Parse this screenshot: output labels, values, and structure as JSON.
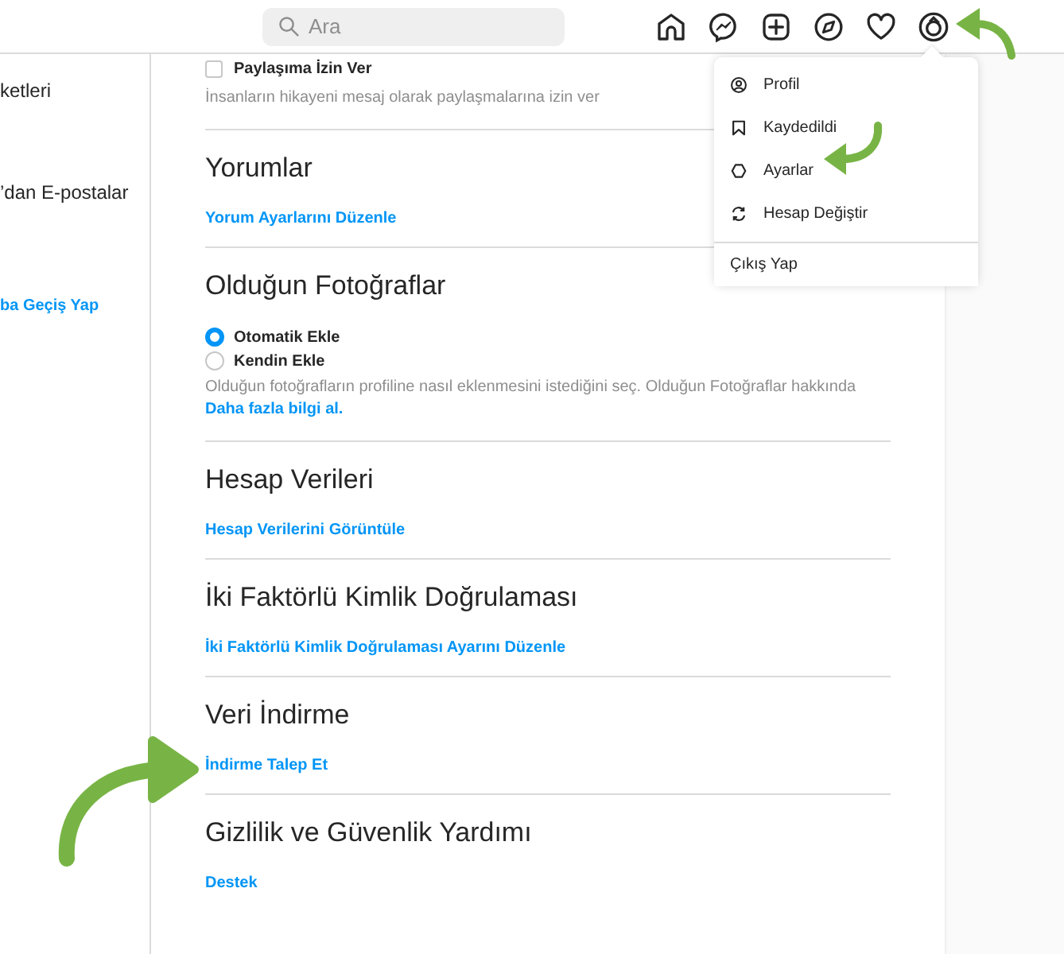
{
  "header": {
    "search": {
      "placeholder": "Ara"
    },
    "nav_icons": [
      {
        "kind": "home"
      },
      {
        "kind": "messenger"
      },
      {
        "kind": "new-post"
      },
      {
        "kind": "explore"
      },
      {
        "kind": "activity"
      },
      {
        "kind": "profile"
      }
    ]
  },
  "sidebar": {
    "items": [
      {
        "label": "ketleri",
        "kind": "plain"
      },
      {
        "label": "’dan E-postalar",
        "kind": "plain"
      },
      {
        "label": "ba Geçiş Yap",
        "kind": "link"
      }
    ]
  },
  "top_option": {
    "label": "Paylaşıma İzin Ver",
    "checked": false,
    "description": "İnsanların hikayeni mesaj olarak paylaşmalarına izin ver"
  },
  "sections": [
    {
      "title": "Yorumlar",
      "link": "Yorum Ayarlarını Düzenle"
    },
    {
      "title": "Olduğun Fotoğraflar",
      "options": [
        {
          "label": "Otomatik Ekle",
          "selected": true
        },
        {
          "label": "Kendin Ekle",
          "selected": false
        }
      ],
      "description": "Olduğun fotoğrafların profiline nasıl eklenmesini istediğini seç. Olduğun Fotoğraflar hakkında",
      "description_link": "Daha fazla bilgi al."
    },
    {
      "title": "Hesap Verileri",
      "link": "Hesap Verilerini Görüntüle"
    },
    {
      "title": "İki Faktörlü Kimlik Doğrulaması",
      "link": "İki Faktörlü Kimlik Doğrulaması Ayarını Düzenle"
    },
    {
      "title": "Veri İndirme",
      "link": "İndirme Talep Et"
    },
    {
      "title": "Gizlilik ve Güvenlik Yardımı",
      "link": "Destek"
    }
  ],
  "menu": {
    "items": [
      {
        "label": "Profil",
        "kind": "profile"
      },
      {
        "label": "Kaydedildi",
        "kind": "bookmark"
      },
      {
        "label": "Ayarlar",
        "kind": "settings"
      },
      {
        "label": "Hesap Değiştir",
        "kind": "switch"
      }
    ],
    "footer": "Çıkış Yap"
  }
}
